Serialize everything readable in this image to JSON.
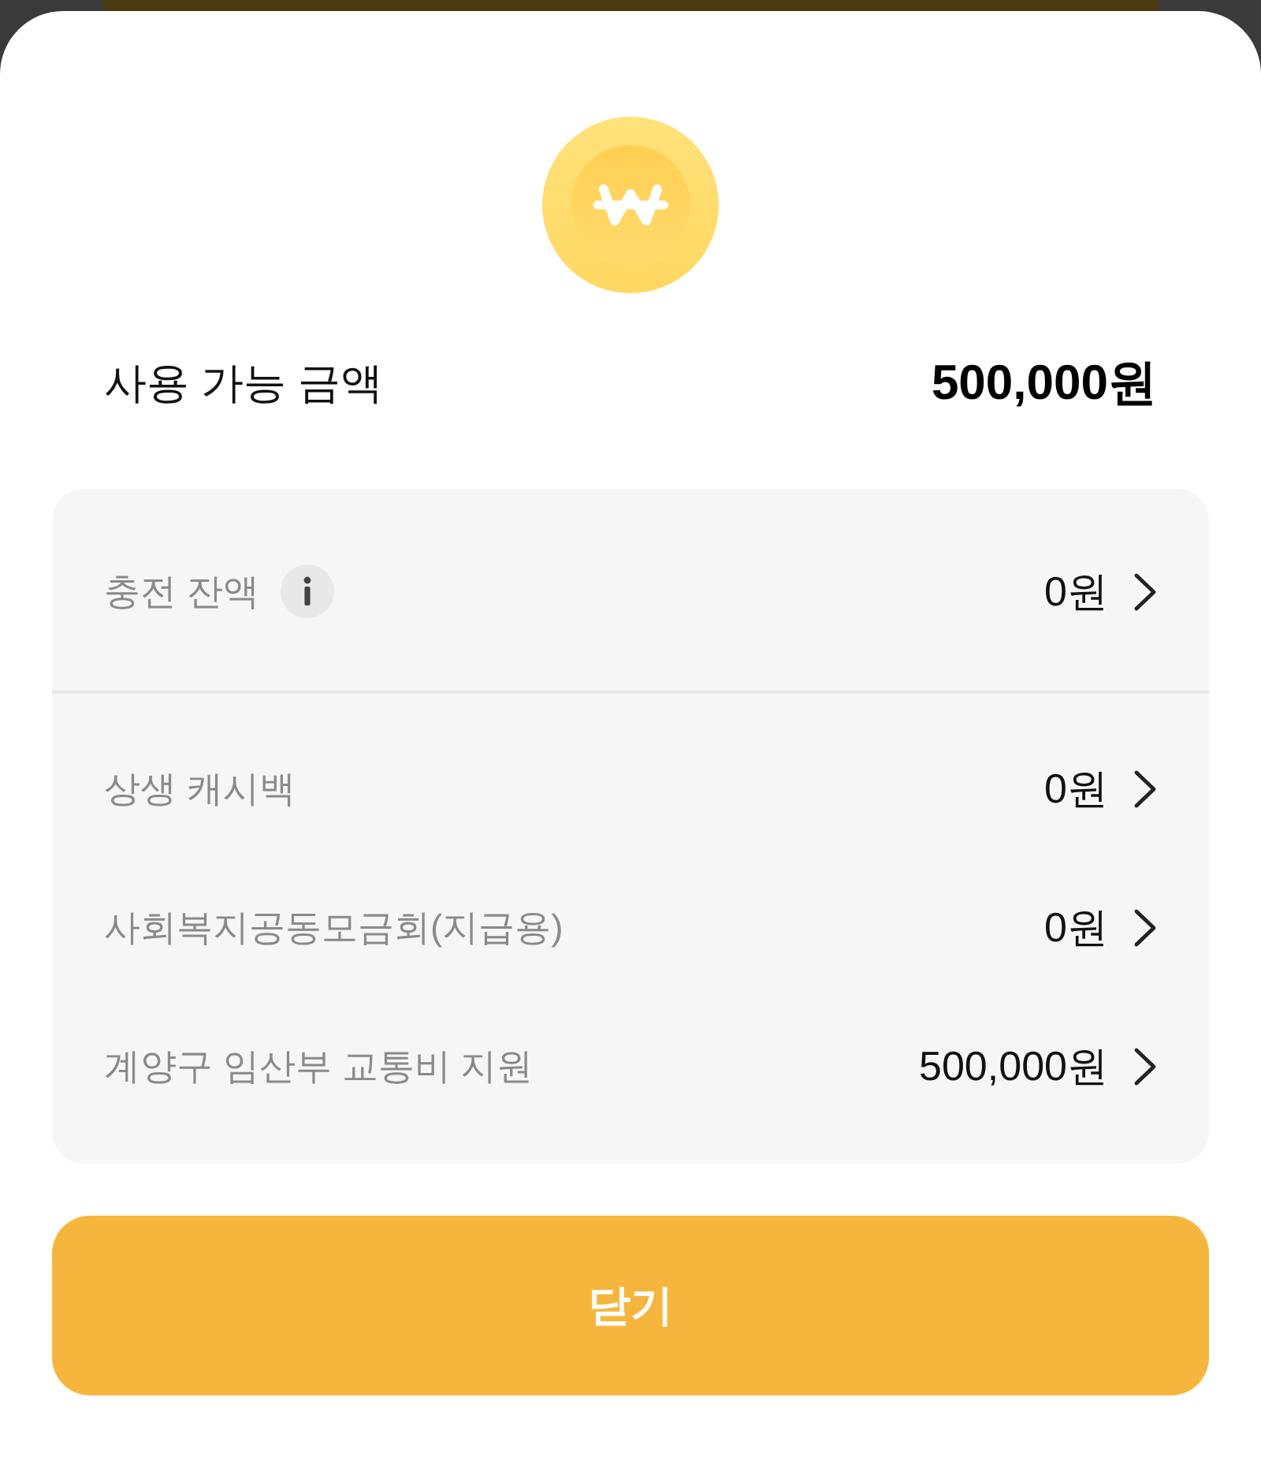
{
  "summary": {
    "label": "사용 가능 금액",
    "amount": "500,000원"
  },
  "charge_balance": {
    "label": "충전 잔액",
    "amount": "0원"
  },
  "benefits": [
    {
      "label": "상생 캐시백",
      "amount": "0원"
    },
    {
      "label": "사회복지공동모금회(지급용)",
      "amount": "0원"
    },
    {
      "label": "계양구 임산부 교통비 지원",
      "amount": "500,000원"
    }
  ],
  "close_button": {
    "label": "닫기"
  }
}
